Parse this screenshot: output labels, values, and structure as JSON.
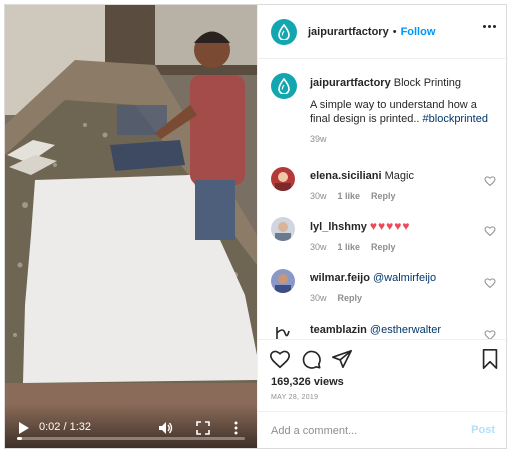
{
  "video": {
    "time": "0:02 / 1:32",
    "progress": 0.022,
    "play_icon": "play-icon",
    "volume_icon": "volume-icon",
    "fullscreen_icon": "fullscreen-icon",
    "more_icon": "more-vertical-icon"
  },
  "header": {
    "username": "jaipurartfactory",
    "separator": "•",
    "follow_label": "Follow",
    "avatar_color": "#13a6b1"
  },
  "caption": {
    "username": "jaipurartfactory",
    "title": "Block Printing",
    "text": "A simple way to understand how a final design is printed.. ",
    "hashtag": "#blockprinted",
    "age": "39w"
  },
  "comments": [
    {
      "username": "elena.siciliani",
      "text": "Magic",
      "age": "30w",
      "likes": "1 like",
      "reply": "Reply"
    },
    {
      "username": "lyl_lhshmy",
      "text": "♥♥♥♥♥",
      "age": "30w",
      "likes": "1 like",
      "reply": "Reply"
    },
    {
      "username": "wilmar.feijo",
      "text": "@walmirfeijo",
      "age": "30w",
      "likes": "",
      "reply": "Reply"
    },
    {
      "username": "teamblazin",
      "text": "@estherwalter",
      "age": "",
      "likes": "",
      "reply": ""
    }
  ],
  "stats": {
    "views": "169,326 views",
    "date": "MAY 28, 2019"
  },
  "add_comment": {
    "placeholder": "Add a comment...",
    "post_label": "Post"
  },
  "colors": {
    "link": "#0095f6",
    "hashtag": "#00376b",
    "heart": "#ed4956",
    "post_disabled": "#b2dffc"
  }
}
